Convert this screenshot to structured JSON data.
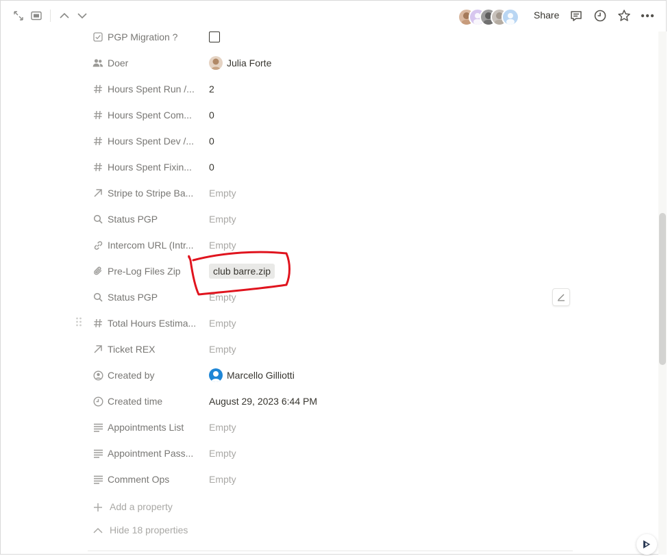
{
  "header": {
    "share_label": "Share",
    "icons": [
      "expand-icon",
      "side-peek-icon",
      "chevron-up-icon",
      "chevron-down-icon",
      "comment-icon",
      "clock-icon",
      "star-icon",
      "more-icon"
    ]
  },
  "properties": [
    {
      "icon": "checkbox-icon",
      "name": "PGP Migration ?",
      "type": "checkbox",
      "value": ""
    },
    {
      "icon": "people-icon",
      "name": "Doer",
      "type": "person",
      "value": "Julia Forte"
    },
    {
      "icon": "hash-icon",
      "name": "Hours Spent Run /...",
      "type": "text",
      "value": "2"
    },
    {
      "icon": "hash-icon",
      "name": "Hours Spent Com...",
      "type": "text",
      "value": "0"
    },
    {
      "icon": "hash-icon",
      "name": "Hours Spent Dev /...",
      "type": "text",
      "value": "0"
    },
    {
      "icon": "hash-icon",
      "name": "Hours Spent Fixin...",
      "type": "text",
      "value": "0"
    },
    {
      "icon": "relation-arrow-icon",
      "name": "Stripe to Stripe Ba...",
      "type": "empty",
      "value": "Empty"
    },
    {
      "icon": "search-icon",
      "name": "Status PGP",
      "type": "empty",
      "value": "Empty"
    },
    {
      "icon": "link-icon",
      "name": "Intercom URL (Intr...",
      "type": "empty",
      "value": "Empty"
    },
    {
      "icon": "paperclip-icon",
      "name": "Pre-Log Files Zip",
      "type": "file",
      "value": "club barre.zip"
    },
    {
      "icon": "search-icon",
      "name": "Status PGP",
      "type": "empty",
      "value": "Empty"
    },
    {
      "icon": "hash-icon",
      "name": "Total Hours Estima...",
      "type": "empty",
      "value": "Empty"
    },
    {
      "icon": "relation-arrow-icon",
      "name": "Ticket REX",
      "type": "empty",
      "value": "Empty"
    },
    {
      "icon": "person-circle-icon",
      "name": "Created by",
      "type": "person",
      "value": "Marcello Gilliotti"
    },
    {
      "icon": "clock-icon",
      "name": "Created time",
      "type": "text",
      "value": "August 29, 2023 6:44 PM"
    },
    {
      "icon": "text-lines-icon",
      "name": "Appointments List",
      "type": "empty",
      "value": "Empty"
    },
    {
      "icon": "text-lines-icon",
      "name": "Appointment Pass...",
      "type": "empty",
      "value": "Empty"
    },
    {
      "icon": "text-lines-icon",
      "name": "Comment Ops",
      "type": "empty",
      "value": "Empty"
    }
  ],
  "footer": {
    "add_property_label": "Add a property",
    "hide_properties_label": "Hide 18 properties"
  },
  "colors": {
    "annotation": "#e0141e",
    "text": "#37352f",
    "muted": "#787774",
    "empty": "#a9a8a5"
  }
}
